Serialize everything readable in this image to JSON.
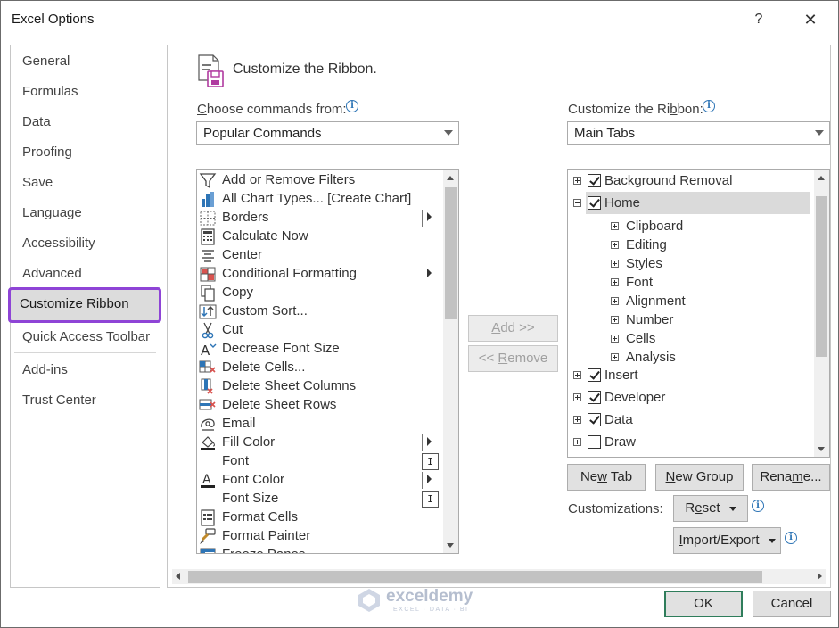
{
  "dialog": {
    "title": "Excel Options",
    "help_label": "?",
    "close_label": "✕"
  },
  "nav": {
    "items": [
      "General",
      "Formulas",
      "Data",
      "Proofing",
      "Save",
      "Language",
      "Accessibility",
      "Advanced"
    ],
    "selected": "Customize Ribbon",
    "items_after": [
      "Quick Access Toolbar"
    ],
    "items_bottom": [
      "Add-ins",
      "Trust Center"
    ]
  },
  "header": {
    "title": "Customize the Ribbon.",
    "icon": "customize-ribbon-icon"
  },
  "left": {
    "label_prefix": "C",
    "label_rest": "hoose commands from:",
    "combo_value": "Popular Commands",
    "commands": [
      {
        "label": "Add or Remove Filters",
        "icon": "filter-icon"
      },
      {
        "label": "All Chart Types... [Create Chart]",
        "icon": "chart-icon"
      },
      {
        "label": "Borders",
        "icon": "borders-icon",
        "extra": "arrow-sep"
      },
      {
        "label": "Calculate Now",
        "icon": "calculator-icon"
      },
      {
        "label": "Center",
        "icon": "center-icon"
      },
      {
        "label": "Conditional Formatting",
        "icon": "conditional-formatting-icon",
        "extra": "arrow"
      },
      {
        "label": "Copy",
        "icon": "copy-icon"
      },
      {
        "label": "Custom Sort...",
        "icon": "sort-icon"
      },
      {
        "label": "Cut",
        "icon": "scissors-icon"
      },
      {
        "label": "Decrease Font Size",
        "icon": "decrease-font-icon"
      },
      {
        "label": "Delete Cells...",
        "icon": "delete-cells-icon"
      },
      {
        "label": "Delete Sheet Columns",
        "icon": "delete-columns-icon"
      },
      {
        "label": "Delete Sheet Rows",
        "icon": "delete-rows-icon"
      },
      {
        "label": "Email",
        "icon": "email-icon"
      },
      {
        "label": "Fill Color",
        "icon": "fill-color-icon",
        "extra": "arrow-sep"
      },
      {
        "label": "Font",
        "icon": "none",
        "extra": "ibox"
      },
      {
        "label": "Font Color",
        "icon": "font-color-icon",
        "extra": "arrow-sep"
      },
      {
        "label": "Font Size",
        "icon": "none",
        "extra": "ibox"
      },
      {
        "label": "Format Cells",
        "icon": "format-cells-icon"
      },
      {
        "label": "Format Painter",
        "icon": "format-painter-icon"
      },
      {
        "label": "Freeze Panes",
        "icon": "freeze-panes-icon"
      }
    ],
    "ibox_glyph": "I"
  },
  "middle": {
    "add_label": "Add >>",
    "add_underline": "A",
    "remove_prefix": "<< ",
    "remove_underline": "R",
    "remove_rest": "emove"
  },
  "right": {
    "label_prefix": "Customize the Ri",
    "label_underline": "b",
    "label_rest": "bon:",
    "combo_value": "Main Tabs",
    "tree": [
      {
        "label": "Background Removal",
        "level": 0,
        "expander": "plus",
        "checked": true
      },
      {
        "label": "Home",
        "level": 0,
        "expander": "minus",
        "checked": true,
        "selected": true
      },
      {
        "label": "Clipboard",
        "level": 1,
        "expander": "plus"
      },
      {
        "label": "Editing",
        "level": 1,
        "expander": "plus"
      },
      {
        "label": "Styles",
        "level": 1,
        "expander": "plus"
      },
      {
        "label": "Font",
        "level": 1,
        "expander": "plus"
      },
      {
        "label": "Alignment",
        "level": 1,
        "expander": "plus"
      },
      {
        "label": "Number",
        "level": 1,
        "expander": "plus"
      },
      {
        "label": "Cells",
        "level": 1,
        "expander": "plus"
      },
      {
        "label": "Analysis",
        "level": 1,
        "expander": "plus"
      },
      {
        "label": "Insert",
        "level": 0,
        "expander": "plus",
        "checked": true
      },
      {
        "label": "Developer",
        "level": 0,
        "expander": "plus",
        "checked": true
      },
      {
        "label": "Data",
        "level": 0,
        "expander": "plus",
        "checked": true
      },
      {
        "label": "Draw",
        "level": 0,
        "expander": "plus",
        "checked": false
      }
    ],
    "new_tab_prefix": "Ne",
    "new_tab_underline": "w",
    "new_tab_rest": " Tab",
    "new_group_underline": "N",
    "new_group_rest": "ew Group",
    "rename_prefix": "Rena",
    "rename_underline": "m",
    "rename_rest": "e...",
    "customizations_label": "Customizations:",
    "reset_prefix": "R",
    "reset_underline": "e",
    "reset_rest": "set",
    "import_export_underline": "I",
    "import_export_rest": "mport/Export"
  },
  "footer": {
    "ok_label": "OK",
    "cancel_label": "Cancel"
  },
  "watermark": {
    "text": "exceldemy",
    "sub": "EXCEL · DATA · BI"
  },
  "colors": {
    "accent": "#8e44d6",
    "ok_border": "#2f7d5b",
    "info": "#2e75b6"
  }
}
